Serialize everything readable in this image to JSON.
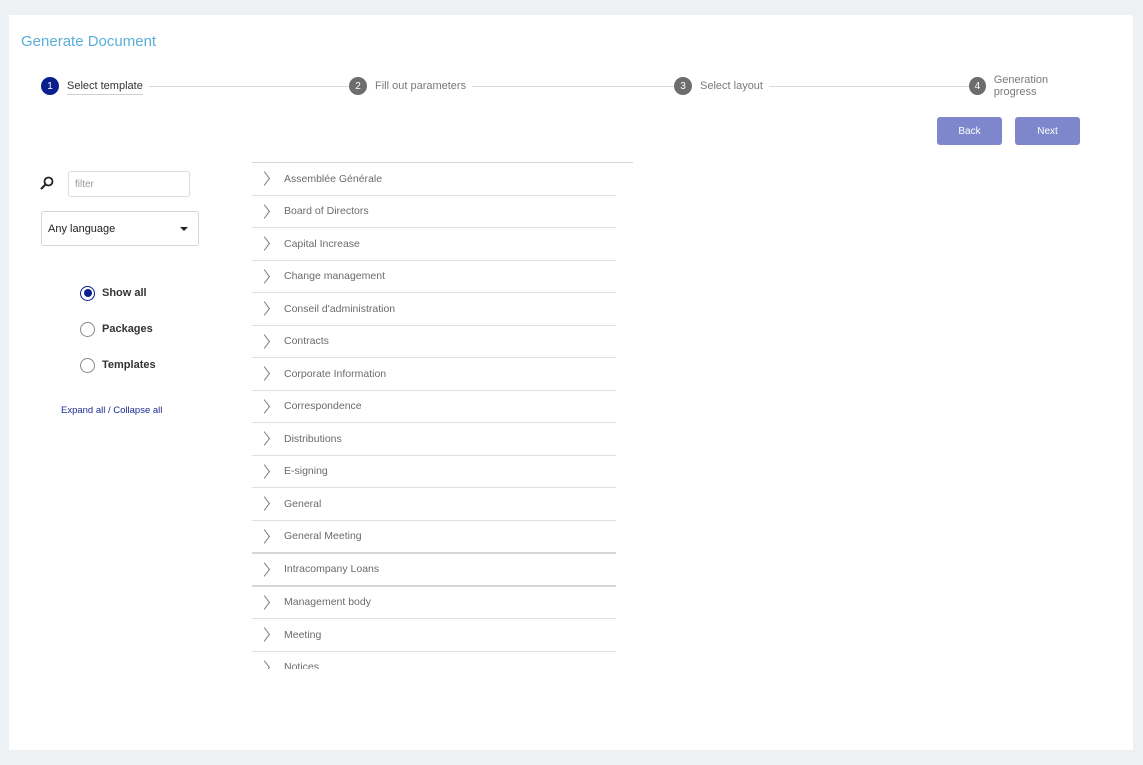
{
  "header": {
    "title": "Generate Document"
  },
  "stepper": {
    "steps": [
      {
        "number": "1",
        "label": "Select template",
        "active": true
      },
      {
        "number": "2",
        "label": "Fill out parameters",
        "active": false
      },
      {
        "number": "3",
        "label": "Select layout",
        "active": false
      },
      {
        "number": "4",
        "label": "Generation progress",
        "active": false
      }
    ]
  },
  "actions": {
    "back_label": "Back",
    "next_label": "Next"
  },
  "filters": {
    "search_icon": "search-icon",
    "filter_placeholder": "filter",
    "filter_value": "",
    "language_selected": "Any language",
    "view_options": [
      {
        "label": "Show all",
        "checked": true
      },
      {
        "label": "Packages",
        "checked": false
      },
      {
        "label": "Templates",
        "checked": false
      }
    ],
    "expand_collapse_label": "Expand all / Collapse all"
  },
  "tree": {
    "items": [
      {
        "label": "Assemblée Générale"
      },
      {
        "label": "Board of Directors"
      },
      {
        "label": "Capital Increase"
      },
      {
        "label": "Change management"
      },
      {
        "label": "Conseil d'administration"
      },
      {
        "label": "Contracts"
      },
      {
        "label": "Corporate Information"
      },
      {
        "label": "Correspondence"
      },
      {
        "label": "Distributions"
      },
      {
        "label": "E-signing"
      },
      {
        "label": "General"
      },
      {
        "label": "General Meeting"
      },
      {
        "label": "Intracompany Loans"
      },
      {
        "label": "Management body"
      },
      {
        "label": "Meeting"
      },
      {
        "label": "Notices"
      }
    ]
  },
  "colors": {
    "title": "#5aaed8",
    "active_step": "#0a1e8c",
    "inactive_step": "#6d6d6d",
    "button": "#7e87cb",
    "link": "#1a2c8f",
    "background": "#eef1f3"
  }
}
